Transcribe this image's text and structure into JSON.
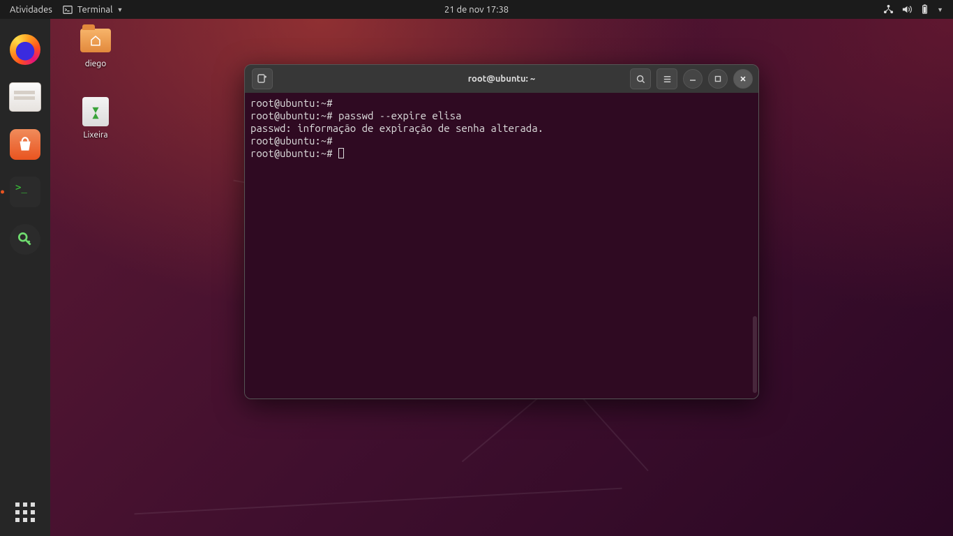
{
  "topbar": {
    "activities": "Atividades",
    "app_name": "Terminal",
    "datetime": "21 de nov  17:38"
  },
  "desktop_icons": [
    {
      "label": "diego"
    },
    {
      "label": "Lixeira"
    }
  ],
  "terminal": {
    "title": "root@ubuntu: ~",
    "lines": [
      "root@ubuntu:~#",
      "root@ubuntu:~# passwd --expire elisa",
      "passwd: informação de expiração de senha alterada.",
      "root@ubuntu:~#",
      "root@ubuntu:~# "
    ]
  }
}
